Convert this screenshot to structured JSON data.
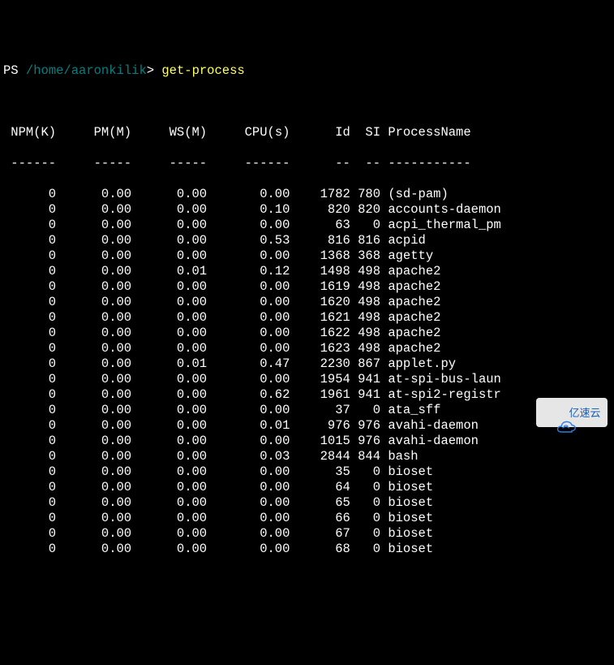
{
  "prompt": {
    "ps": "PS",
    "path": "/home/aaronkilik",
    "end": ">",
    "command": "get-process"
  },
  "columns": {
    "npm": "NPM(K)",
    "pm": "PM(M)",
    "ws": "WS(M)",
    "cpu": "CPU(s)",
    "id": "Id",
    "si": "SI",
    "name": "ProcessName"
  },
  "dividers": {
    "npm": "------",
    "pm": "-----",
    "ws": "-----",
    "cpu": "------",
    "id": "--",
    "si": "--",
    "name": "-----------"
  },
  "rows": [
    {
      "npm": "0",
      "pm": "0.00",
      "ws": "0.00",
      "cpu": "0.00",
      "id": "1782",
      "si": "780",
      "name": "(sd-pam)"
    },
    {
      "npm": "0",
      "pm": "0.00",
      "ws": "0.00",
      "cpu": "0.10",
      "id": "820",
      "si": "820",
      "name": "accounts-daemon"
    },
    {
      "npm": "0",
      "pm": "0.00",
      "ws": "0.00",
      "cpu": "0.00",
      "id": "63",
      "si": "0",
      "name": "acpi_thermal_pm"
    },
    {
      "npm": "0",
      "pm": "0.00",
      "ws": "0.00",
      "cpu": "0.53",
      "id": "816",
      "si": "816",
      "name": "acpid"
    },
    {
      "npm": "0",
      "pm": "0.00",
      "ws": "0.00",
      "cpu": "0.00",
      "id": "1368",
      "si": "368",
      "name": "agetty"
    },
    {
      "npm": "0",
      "pm": "0.00",
      "ws": "0.01",
      "cpu": "0.12",
      "id": "1498",
      "si": "498",
      "name": "apache2"
    },
    {
      "npm": "0",
      "pm": "0.00",
      "ws": "0.00",
      "cpu": "0.00",
      "id": "1619",
      "si": "498",
      "name": "apache2"
    },
    {
      "npm": "0",
      "pm": "0.00",
      "ws": "0.00",
      "cpu": "0.00",
      "id": "1620",
      "si": "498",
      "name": "apache2"
    },
    {
      "npm": "0",
      "pm": "0.00",
      "ws": "0.00",
      "cpu": "0.00",
      "id": "1621",
      "si": "498",
      "name": "apache2"
    },
    {
      "npm": "0",
      "pm": "0.00",
      "ws": "0.00",
      "cpu": "0.00",
      "id": "1622",
      "si": "498",
      "name": "apache2"
    },
    {
      "npm": "0",
      "pm": "0.00",
      "ws": "0.00",
      "cpu": "0.00",
      "id": "1623",
      "si": "498",
      "name": "apache2"
    },
    {
      "npm": "0",
      "pm": "0.00",
      "ws": "0.01",
      "cpu": "0.47",
      "id": "2230",
      "si": "867",
      "name": "applet.py"
    },
    {
      "npm": "0",
      "pm": "0.00",
      "ws": "0.00",
      "cpu": "0.00",
      "id": "1954",
      "si": "941",
      "name": "at-spi-bus-laun"
    },
    {
      "npm": "0",
      "pm": "0.00",
      "ws": "0.00",
      "cpu": "0.62",
      "id": "1961",
      "si": "941",
      "name": "at-spi2-registr"
    },
    {
      "npm": "0",
      "pm": "0.00",
      "ws": "0.00",
      "cpu": "0.00",
      "id": "37",
      "si": "0",
      "name": "ata_sff"
    },
    {
      "npm": "0",
      "pm": "0.00",
      "ws": "0.00",
      "cpu": "0.01",
      "id": "976",
      "si": "976",
      "name": "avahi-daemon"
    },
    {
      "npm": "0",
      "pm": "0.00",
      "ws": "0.00",
      "cpu": "0.00",
      "id": "1015",
      "si": "976",
      "name": "avahi-daemon"
    },
    {
      "npm": "0",
      "pm": "0.00",
      "ws": "0.00",
      "cpu": "0.03",
      "id": "2844",
      "si": "844",
      "name": "bash"
    },
    {
      "npm": "0",
      "pm": "0.00",
      "ws": "0.00",
      "cpu": "0.00",
      "id": "35",
      "si": "0",
      "name": "bioset"
    },
    {
      "npm": "0",
      "pm": "0.00",
      "ws": "0.00",
      "cpu": "0.00",
      "id": "64",
      "si": "0",
      "name": "bioset"
    },
    {
      "npm": "0",
      "pm": "0.00",
      "ws": "0.00",
      "cpu": "0.00",
      "id": "65",
      "si": "0",
      "name": "bioset"
    },
    {
      "npm": "0",
      "pm": "0.00",
      "ws": "0.00",
      "cpu": "0.00",
      "id": "66",
      "si": "0",
      "name": "bioset"
    },
    {
      "npm": "0",
      "pm": "0.00",
      "ws": "0.00",
      "cpu": "0.00",
      "id": "67",
      "si": "0",
      "name": "bioset"
    },
    {
      "npm": "0",
      "pm": "0.00",
      "ws": "0.00",
      "cpu": "0.00",
      "id": "68",
      "si": "0",
      "name": "bioset"
    }
  ],
  "watermark": {
    "text": "亿速云"
  }
}
